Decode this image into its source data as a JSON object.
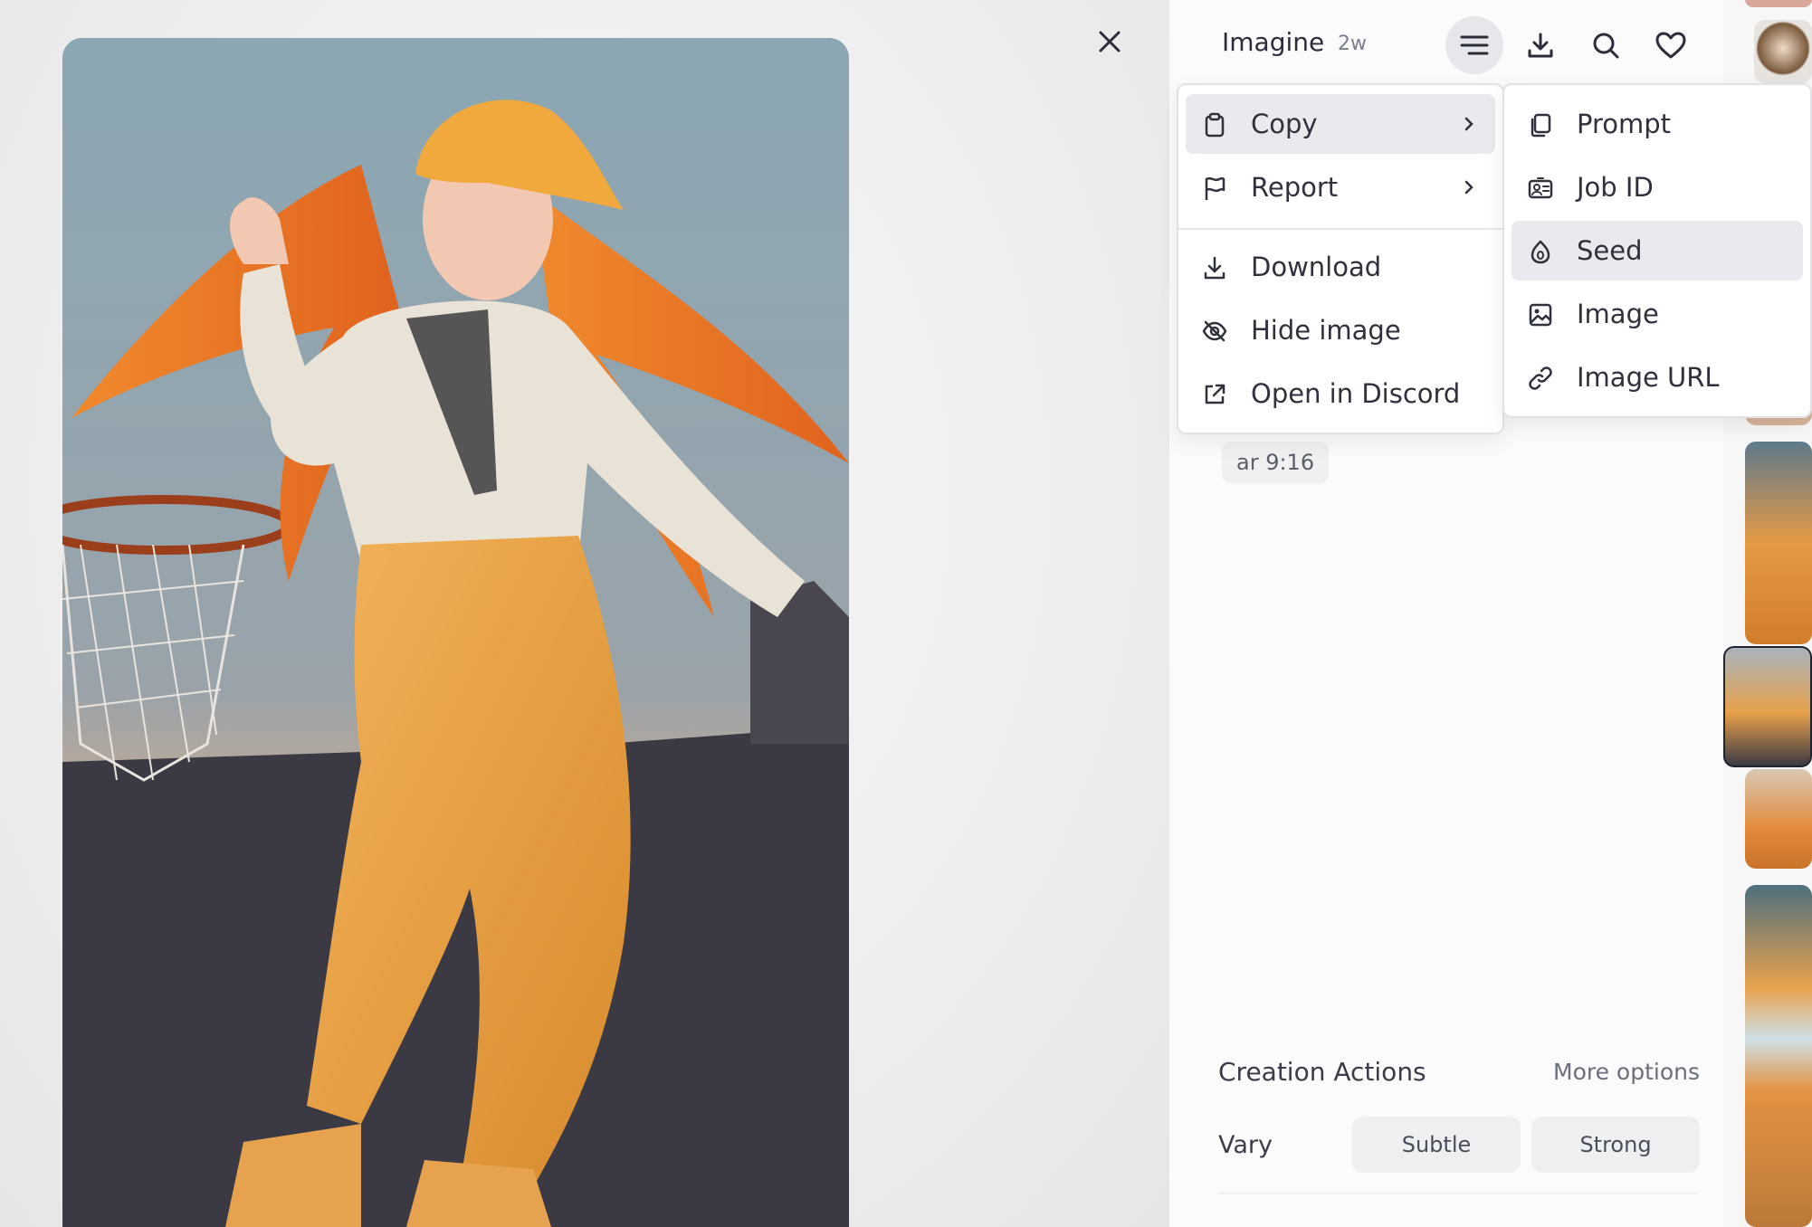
{
  "header": {
    "title": "Imagine",
    "age": "2w"
  },
  "chip": {
    "label": "ar 9:16"
  },
  "menu_main": {
    "items": [
      {
        "label": "Copy",
        "icon": "clipboard-icon",
        "has_submenu": true,
        "highlighted": true
      },
      {
        "label": "Report",
        "icon": "flag-icon",
        "has_submenu": true
      },
      {
        "label": "Download",
        "icon": "download-icon"
      },
      {
        "label": "Hide image",
        "icon": "eye-off-icon"
      },
      {
        "label": "Open in Discord",
        "icon": "external-link-icon"
      }
    ]
  },
  "menu_copy": {
    "items": [
      {
        "label": "Prompt",
        "icon": "copy-icon"
      },
      {
        "label": "Job ID",
        "icon": "id-card-icon"
      },
      {
        "label": "Seed",
        "icon": "seed-icon",
        "highlighted": true
      },
      {
        "label": "Image",
        "icon": "image-icon"
      },
      {
        "label": "Image URL",
        "icon": "link-icon"
      }
    ]
  },
  "creation": {
    "title": "Creation Actions",
    "more": "More options",
    "vary_label": "Vary",
    "subtle": "Subtle",
    "strong": "Strong"
  },
  "colors": {
    "menu_highlight": "#e9eaed",
    "text": "#2f323c",
    "muted": "#7b7f8d"
  }
}
